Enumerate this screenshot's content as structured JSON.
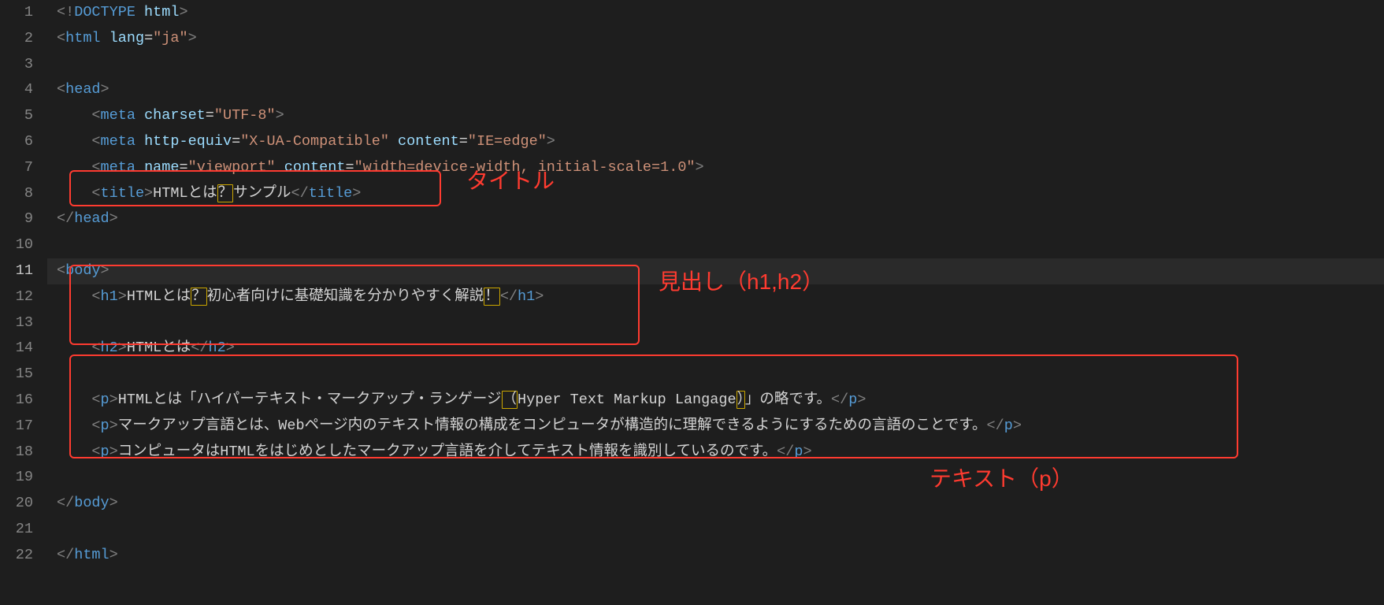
{
  "annotations": {
    "title": "タイトル",
    "heading": "見出し（h1,h2）",
    "text": "テキスト（p）"
  },
  "line_numbers": [
    "1",
    "2",
    "3",
    "4",
    "5",
    "6",
    "7",
    "8",
    "9",
    "10",
    "11",
    "12",
    "13",
    "14",
    "15",
    "16",
    "17",
    "18",
    "19",
    "20",
    "21",
    "22"
  ],
  "active_line": "11",
  "code": {
    "l1": {
      "open": "<!",
      "doctype": "DOCTYPE",
      "sp": " ",
      "html": "html",
      "close": ">"
    },
    "l2": {
      "o": "<",
      "tag": "html",
      "sp": " ",
      "attr": "lang",
      "eq": "=",
      "val": "\"ja\"",
      "c": ">"
    },
    "l4": {
      "o": "<",
      "tag": "head",
      "c": ">"
    },
    "l5": {
      "o": "<",
      "tag": "meta",
      "sp": " ",
      "attr": "charset",
      "eq": "=",
      "val": "\"UTF-8\"",
      "c": ">"
    },
    "l6": {
      "o": "<",
      "tag": "meta",
      "sp": " ",
      "a1": "http-equiv",
      "eq1": "=",
      "v1": "\"X-UA-Compatible\"",
      "sp2": " ",
      "a2": "content",
      "eq2": "=",
      "v2": "\"IE=edge\"",
      "c": ">"
    },
    "l7": {
      "o": "<",
      "tag": "meta",
      "sp": " ",
      "a1": "name",
      "eq1": "=",
      "v1": "\"viewport\"",
      "sp2": " ",
      "a2": "content",
      "eq2": "=",
      "v2": "\"width=device-width, initial-scale=1.0\"",
      "c": ">"
    },
    "l8": {
      "o": "<",
      "tag": "title",
      "c": ">",
      "t1": "HTMLとは",
      "warn": "？",
      "t2": "サンプル",
      "co": "</",
      "ctag": "title",
      "cc": ">"
    },
    "l9": {
      "o": "</",
      "tag": "head",
      "c": ">"
    },
    "l11": {
      "o": "<",
      "tag": "body",
      "c": ">"
    },
    "l12": {
      "o": "<",
      "tag": "h1",
      "c": ">",
      "t1": "HTMLとは",
      "w1": "？",
      "t2": "初心者向けに基礎知識を分かりやすく解説",
      "w2": "！",
      "co": "</",
      "ctag": "h1",
      "cc": ">"
    },
    "l14": {
      "o": "<",
      "tag": "h2",
      "c": ">",
      "t": "HTMLとは",
      "co": "</",
      "ctag": "h2",
      "cc": ">"
    },
    "l16": {
      "o": "<",
      "tag": "p",
      "c": ">",
      "t1": "HTMLとは「ハイパーテキスト・マークアップ・ランゲージ",
      "w1": "（",
      "t2": "Hyper Text Markup Langage",
      "w2": "）",
      "t3": "」の略です。",
      "co": "</",
      "ctag": "p",
      "cc": ">"
    },
    "l17": {
      "o": "<",
      "tag": "p",
      "c": ">",
      "t": "マークアップ言語とは、Webページ内のテキスト情報の構成をコンピュータが構造的に理解できるようにするための言語のことです。",
      "co": "</",
      "ctag": "p",
      "cc": ">"
    },
    "l18": {
      "o": "<",
      "tag": "p",
      "c": ">",
      "t": "コンピュータはHTMLをはじめとしたマークアップ言語を介してテキスト情報を識別しているのです。",
      "co": "</",
      "ctag": "p",
      "cc": ">"
    },
    "l20": {
      "o": "</",
      "tag": "body",
      "c": ">"
    },
    "l22": {
      "o": "</",
      "tag": "html",
      "c": ">"
    }
  }
}
